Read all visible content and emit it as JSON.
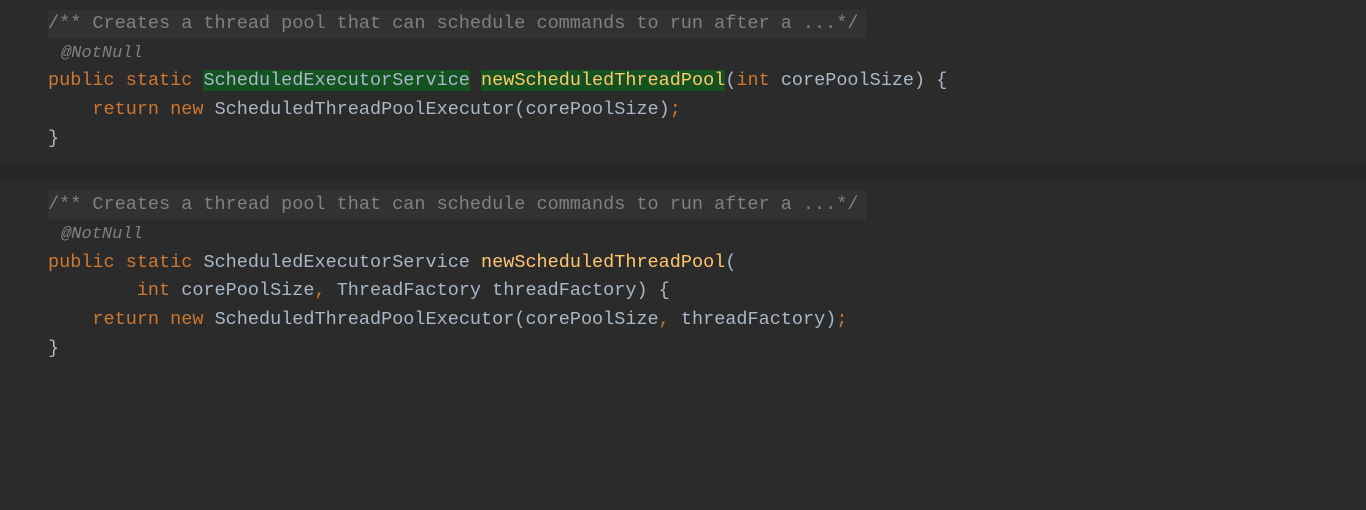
{
  "method1": {
    "javadoc": "/** Creates a thread pool that can schedule commands to run after a ...*/",
    "annotation": "@NotNull",
    "modifier_public": "public",
    "modifier_static": "static",
    "return_type": "ScheduledExecutorService",
    "method_name": "newScheduledThreadPool",
    "param_type": "int",
    "param_name": "corePoolSize",
    "return_keyword": "return",
    "new_keyword": "new",
    "constructor": "ScheduledThreadPoolExecutor",
    "constructor_arg": "corePoolSize"
  },
  "method2": {
    "javadoc": "/** Creates a thread pool that can schedule commands to run after a ...*/",
    "annotation": "@NotNull",
    "modifier_public": "public",
    "modifier_static": "static",
    "return_type": "ScheduledExecutorService",
    "method_name": "newScheduledThreadPool",
    "param1_type": "int",
    "param1_name": "corePoolSize",
    "param2_type": "ThreadFactory",
    "param2_name": "threadFactory",
    "return_keyword": "return",
    "new_keyword": "new",
    "constructor": "ScheduledThreadPoolExecutor",
    "constructor_arg1": "corePoolSize",
    "constructor_arg2": "threadFactory"
  }
}
